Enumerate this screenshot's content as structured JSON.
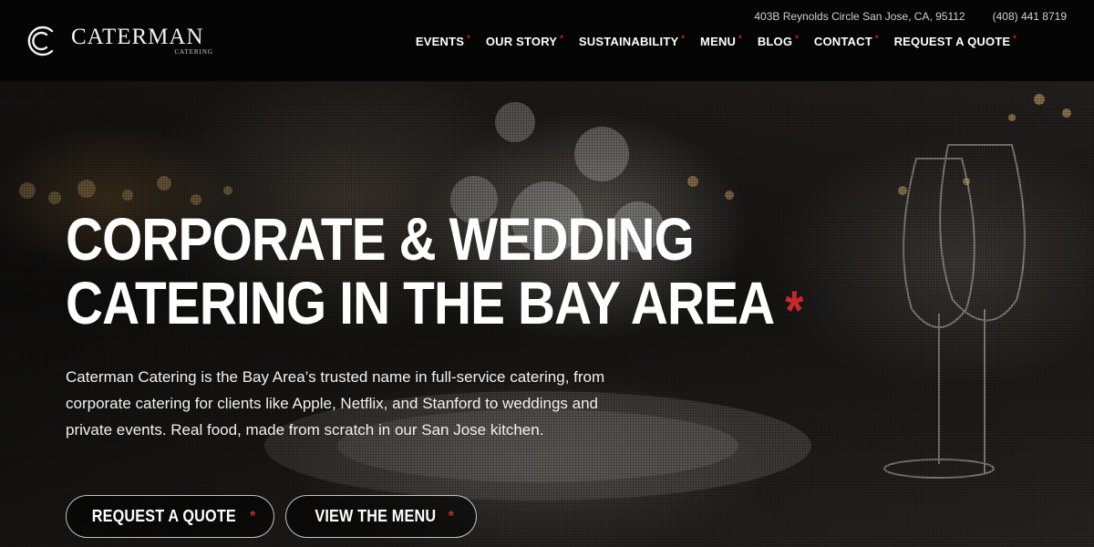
{
  "brand": {
    "name": "CATERMAN",
    "sub": "CATERING",
    "logo_icon": "circle-c-logo-icon"
  },
  "topbar": {
    "address": "403B Reynolds Circle San Jose, CA, 95112",
    "phone": "(408) 441 8719"
  },
  "nav": {
    "items": [
      {
        "label": "EVENTS"
      },
      {
        "label": "OUR STORY"
      },
      {
        "label": "SUSTAINABILITY"
      },
      {
        "label": "MENU"
      },
      {
        "label": "BLOG"
      },
      {
        "label": "CONTACT"
      },
      {
        "label": "REQUEST A QUOTE"
      }
    ],
    "marker": "*"
  },
  "hero": {
    "headline_line1": "CORPORATE & WEDDING",
    "headline_line2": "CATERING IN THE BAY AREA",
    "headline_marker": "*",
    "description": "Caterman Catering is the Bay Area’s trusted name in full-service catering, from corporate catering for clients like Apple, Netflix, and Stanford to weddings and private events. Real food, made from scratch in our San Jose kitchen.",
    "buttons": [
      {
        "label": "REQUEST A QUOTE"
      },
      {
        "label": "VIEW THE MENU"
      }
    ],
    "button_marker": "*"
  },
  "colors": {
    "accent": "#c8282d",
    "header_bg": "#050505",
    "text": "#ffffff"
  }
}
